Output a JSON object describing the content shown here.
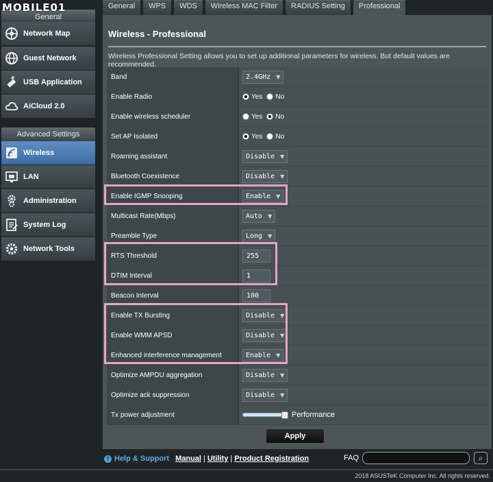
{
  "watermark": "MOBILE01",
  "sidebar": {
    "general_header": "General",
    "general_items": [
      {
        "label": "Network Map",
        "icon": "network-map-icon"
      },
      {
        "label": "Guest Network",
        "icon": "globe-icon"
      },
      {
        "label": "USB Application",
        "icon": "usb-icon"
      },
      {
        "label": "AiCloud 2.0",
        "icon": "cloud-icon"
      }
    ],
    "advanced_header": "Advanced Settings",
    "advanced_items": [
      {
        "label": "Wireless",
        "icon": "wifi-icon",
        "active": true
      },
      {
        "label": "LAN",
        "icon": "lan-icon"
      },
      {
        "label": "Administration",
        "icon": "admin-gear-icon"
      },
      {
        "label": "System Log",
        "icon": "log-icon"
      },
      {
        "label": "Network Tools",
        "icon": "tools-gear-icon"
      }
    ]
  },
  "tabs": [
    "General",
    "WPS",
    "WDS",
    "Wireless MAC Filter",
    "RADIUS Setting",
    "Professional"
  ],
  "active_tab": "Professional",
  "panel": {
    "title": "Wireless - Professional",
    "description": "Wireless Professional Setting allows you to set up additional parameters for wireless. But default values are recommended."
  },
  "settings": [
    {
      "label": "Band",
      "type": "select",
      "value": "2.4GHz"
    },
    {
      "label": "Enable Radio",
      "type": "radio",
      "options": [
        "Yes",
        "No"
      ],
      "selected": "Yes"
    },
    {
      "label": "Enable wireless scheduler",
      "type": "radio",
      "options": [
        "Yes",
        "No"
      ],
      "selected": "No"
    },
    {
      "label": "Set AP Isolated",
      "type": "radio",
      "options": [
        "Yes",
        "No"
      ],
      "selected": "Yes"
    },
    {
      "label": "Roaming assistant",
      "type": "select",
      "value": "Disable"
    },
    {
      "label": "Bluetooth Coexistence",
      "type": "select",
      "value": "Disable"
    },
    {
      "label": "Enable IGMP Snooping",
      "type": "select",
      "value": "Enable"
    },
    {
      "label": "Multicast Rate(Mbps)",
      "type": "select",
      "value": "Auto"
    },
    {
      "label": "Preamble Type",
      "type": "select",
      "value": "Long"
    },
    {
      "label": "RTS Threshold",
      "type": "text",
      "value": "255"
    },
    {
      "label": "DTIM Interval",
      "type": "text",
      "value": "1"
    },
    {
      "label": "Beacon Interval",
      "type": "text",
      "value": "100"
    },
    {
      "label": "Enable TX Bursting",
      "type": "select",
      "value": "Disable"
    },
    {
      "label": "Enable WMM APSD",
      "type": "select",
      "value": "Disable"
    },
    {
      "label": "Enhanced interference management",
      "type": "select",
      "value": "Enable"
    },
    {
      "label": "Optimize AMPDU aggregation",
      "type": "select",
      "value": "Disable"
    },
    {
      "label": "Optimize ack suppression",
      "type": "select",
      "value": "Disable"
    },
    {
      "label": "Tx power adjustment",
      "type": "slider",
      "level": 1.0,
      "value_label": "Performance"
    }
  ],
  "apply_label": "Apply",
  "footer": {
    "help_label": "Help & Support",
    "links": [
      "Manual",
      "Utility",
      "Product Registration"
    ],
    "faq_label": "FAQ",
    "copyright": "2018 ASUSTeK Computer Inc. All rights reserved."
  },
  "colors": {
    "highlight": "#e7a3c8",
    "active_menu": "#4f7fb4",
    "help_link": "#63a9e1"
  }
}
